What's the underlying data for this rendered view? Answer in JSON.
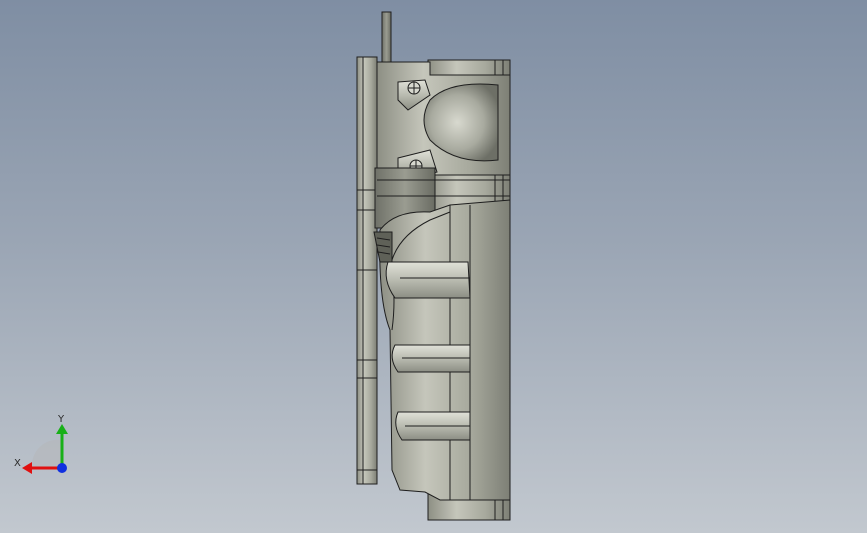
{
  "viewport": {
    "background_top": "#7f8ea3",
    "background_bottom": "#c2c8cf",
    "model_color": "#aeb0a4",
    "edge_color": "#1e1e1e"
  },
  "triad": {
    "x_label": "X",
    "y_label": "Y",
    "x_color": "#e01010",
    "y_color": "#18b018",
    "z_color": "#1030e0"
  }
}
